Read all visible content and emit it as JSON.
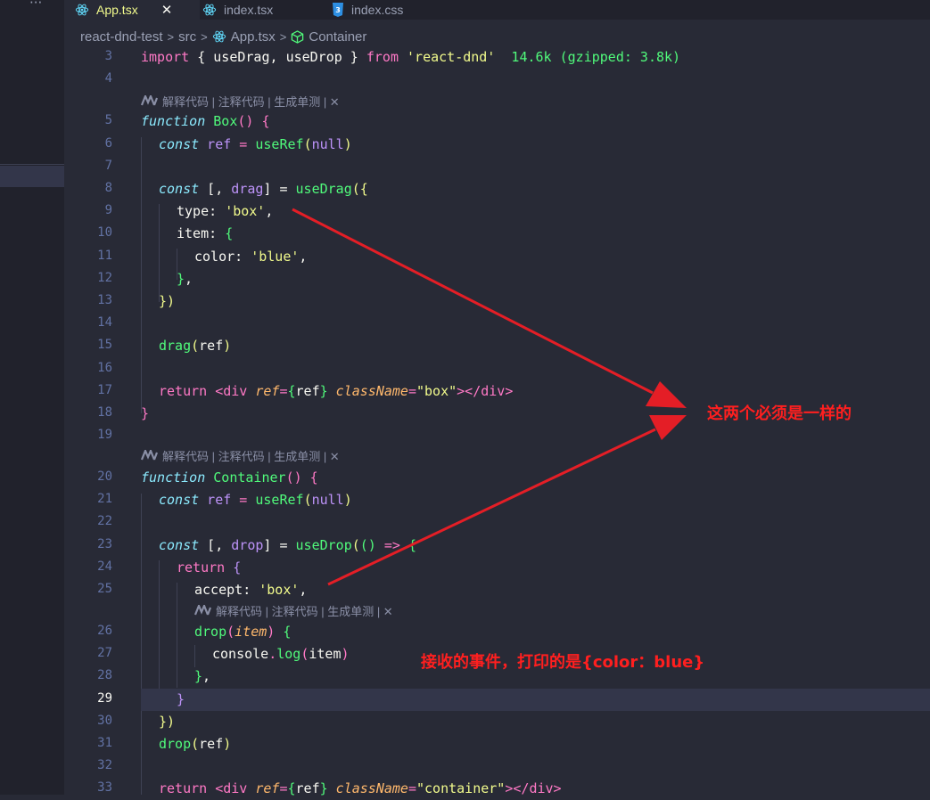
{
  "tabs": [
    {
      "label": "App.tsx",
      "icon": "react-icon",
      "active": true
    },
    {
      "label": "index.tsx",
      "icon": "react-icon",
      "active": false
    },
    {
      "label": "index.css",
      "icon": "css-icon",
      "active": false
    }
  ],
  "tab_close": "✕",
  "sidebar_more": "···",
  "breadcrumb": {
    "project": "react-dnd-test",
    "folder": "src",
    "file": "App.tsx",
    "symbol": "Container",
    "sep": ">"
  },
  "codelens": "解释代码 | 注释代码 | 生成单测 | ✕",
  "code": {
    "l3": {
      "n": "3",
      "import": "import",
      "open": " { ",
      "useDrag": "useDrag",
      "comma": ", ",
      "useDrop": "useDrop",
      "close": " } ",
      "from": "from",
      "sp": " ",
      "module": "'react-dnd'",
      "size": "  14.6k (gzipped: 3.8k)"
    },
    "l4": {
      "n": "4"
    },
    "l5": {
      "n": "5",
      "kw": "function",
      "sp": " ",
      "name": "Box",
      "paren": "()",
      "brace": " {"
    },
    "l6": {
      "n": "6",
      "kw": "const",
      "var": " ref",
      "eq": " = ",
      "fn": "useRef",
      "o": "(",
      "val": "null",
      "c": ")"
    },
    "l7": {
      "n": "7"
    },
    "l8": {
      "n": "8",
      "kw": "const",
      "a": " [, ",
      "var": "drag",
      "b": "] = ",
      "fn": "useDrag",
      "o": "({"
    },
    "l9": {
      "n": "9",
      "prop": "type",
      "colon": ": ",
      "str": "'box'",
      "end": ","
    },
    "l10": {
      "n": "10",
      "prop": "item",
      "colon": ": ",
      "brace": "{"
    },
    "l11": {
      "n": "11",
      "prop": "color",
      "colon": ": ",
      "str": "'blue'",
      "end": ","
    },
    "l12": {
      "n": "12",
      "brace": "}",
      "end": ","
    },
    "l13": {
      "n": "13",
      "txt": "})"
    },
    "l14": {
      "n": "14"
    },
    "l15": {
      "n": "15",
      "fn": "drag",
      "o": "(",
      "arg": "ref",
      "c": ")"
    },
    "l16": {
      "n": "16"
    },
    "l17": {
      "n": "17",
      "kw": "return",
      "lt": " <",
      "tag": "div",
      "attr1": " ref",
      "eq": "=",
      "b1": "{",
      "v": "ref",
      "b2": "}",
      "attr2": " className",
      "eq2": "=",
      "str": "\"box\"",
      "close": "></",
      "tag2": "div",
      "gt": ">"
    },
    "l18": {
      "n": "18",
      "txt": "}"
    },
    "l19": {
      "n": "19"
    },
    "l20": {
      "n": "20",
      "kw": "function",
      "sp": " ",
      "name": "Container",
      "paren": "()",
      "brace": " {"
    },
    "l21": {
      "n": "21",
      "kw": "const",
      "var": " ref",
      "eq": " = ",
      "fn": "useRef",
      "o": "(",
      "val": "null",
      "c": ")"
    },
    "l22": {
      "n": "22"
    },
    "l23": {
      "n": "23",
      "kw": "const",
      "a": " [, ",
      "var": "drop",
      "b": "] = ",
      "fn": "useDrop",
      "o": "(",
      "args": "()",
      "arrow": " => ",
      "brace": "{"
    },
    "l24": {
      "n": "24",
      "kw": "return",
      "brace": " {"
    },
    "l25": {
      "n": "25",
      "prop": "accept",
      "colon": ": ",
      "str": "'box'",
      "end": ","
    },
    "l26": {
      "n": "26",
      "fn": "drop",
      "o": "(",
      "param": "item",
      "c": ")",
      "brace": " {"
    },
    "l27": {
      "n": "27",
      "obj": "console",
      "dot": ".",
      "fn": "log",
      "o": "(",
      "arg": "item",
      "c": ")"
    },
    "l28": {
      "n": "28",
      "brace": "}",
      "end": ","
    },
    "l29": {
      "n": "29",
      "brace": "}"
    },
    "l30": {
      "n": "30",
      "txt": "})"
    },
    "l31": {
      "n": "31",
      "fn": "drop",
      "o": "(",
      "arg": "ref",
      "c": ")"
    },
    "l32": {
      "n": "32"
    },
    "l33": {
      "n": "33",
      "kw": "return",
      "lt": " <",
      "tag": "div",
      "attr1": " ref",
      "eq": "=",
      "b1": "{",
      "v": "ref",
      "b2": "}",
      "attr2": " className",
      "eq2": "=",
      "str": "\"container\"",
      "close": "></",
      "tag2": "div",
      "gt": ">"
    }
  },
  "annotations": {
    "arrow_label": "这两个必须是一样的",
    "receive_label": "接收的事件，打印的是{color：blue}",
    "color": "#ff1f1f"
  },
  "colors": {
    "background": "#282a36",
    "keyword": "#ff79c6",
    "function": "#50fa7b",
    "string": "#f1fa8c",
    "property": "#ffb86c",
    "variable": "#bd93f9",
    "line_number": "#6272a4"
  }
}
